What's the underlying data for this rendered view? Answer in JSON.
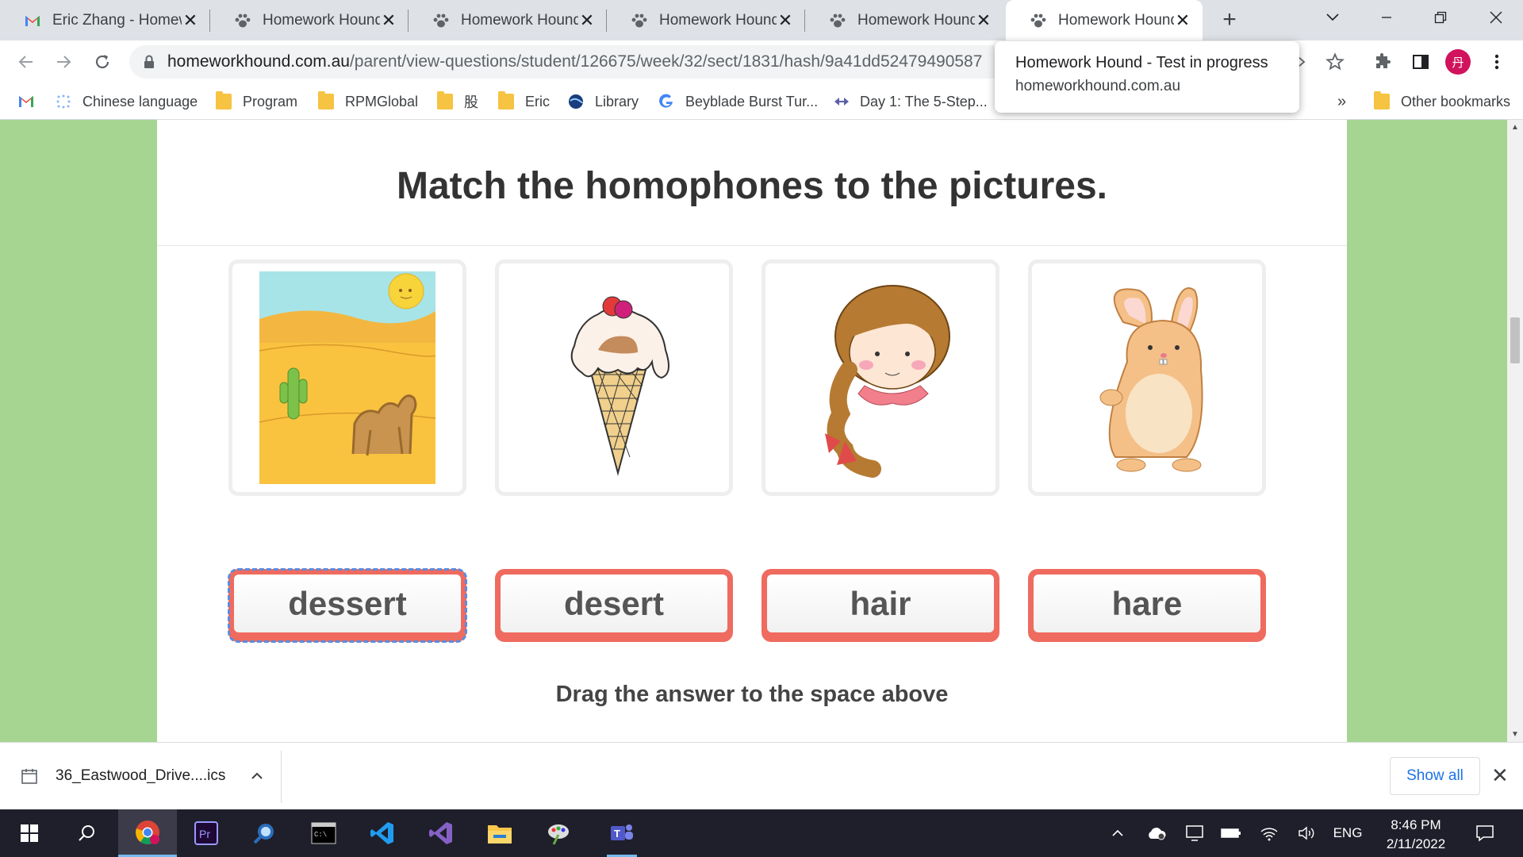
{
  "browser": {
    "tabs": [
      {
        "title": "Eric Zhang - Homew",
        "icon": "gmail-icon"
      },
      {
        "title": "Homework Hound",
        "icon": "paw-icon"
      },
      {
        "title": "Homework Hound",
        "icon": "paw-icon"
      },
      {
        "title": "Homework Hound",
        "icon": "paw-icon"
      },
      {
        "title": "Homework Hound",
        "icon": "paw-icon"
      },
      {
        "title": "Homework Hound",
        "icon": "paw-icon",
        "active": true
      }
    ],
    "new_tab_label": "+",
    "address": {
      "host": "homeworkhound.com.au",
      "path": "/parent/view-questions/student/126675/week/32/sect/1831/hash/9a41dd52479490587"
    },
    "hover_card": {
      "title": "Homework Hound - Test in progress",
      "url": "homeworkhound.com.au"
    },
    "profile_initial": "丹",
    "bookmarks": [
      {
        "label": "",
        "icon": "gmail-icon"
      },
      {
        "label": "Chinese language",
        "icon": "globe-dots-icon"
      },
      {
        "label": "Program",
        "icon": "folder-icon"
      },
      {
        "label": "RPMGlobal",
        "icon": "folder-icon"
      },
      {
        "label": "股",
        "icon": "folder-icon"
      },
      {
        "label": "Eric",
        "icon": "folder-icon"
      },
      {
        "label": "Library",
        "icon": "globe-icon"
      },
      {
        "label": "Beyblade Burst Tur...",
        "icon": "google-icon"
      },
      {
        "label": "Day 1: The 5-Step...",
        "icon": "link-icon"
      }
    ],
    "bookmarks_overflow": "»",
    "other_bookmarks": "Other bookmarks"
  },
  "page": {
    "heading": "Match the homophones to the pictures.",
    "pictures": [
      {
        "name": "desert-picture",
        "subject": "desert with cactus and camel"
      },
      {
        "name": "dessert-picture",
        "subject": "ice cream cone"
      },
      {
        "name": "hair-picture",
        "subject": "girl with braided hair"
      },
      {
        "name": "hare-picture",
        "subject": "rabbit"
      }
    ],
    "answers": [
      "dessert",
      "desert",
      "hair",
      "hare"
    ],
    "instruction": "Drag the answer to the space above"
  },
  "downloads": {
    "file": "36_Eastwood_Drive....ics",
    "show_all": "Show all"
  },
  "taskbar": {
    "apps": [
      "chrome-icon",
      "premiere-icon",
      "search-app-icon",
      "terminal-icon",
      "vscode-icon",
      "visual-studio-icon",
      "file-explorer-icon",
      "paint-icon",
      "teams-icon"
    ],
    "language": "ENG",
    "time": "8:46 PM",
    "date": "2/11/2022"
  },
  "colors": {
    "page_background": "#a5d591",
    "answer_border": "#ef6b5f",
    "focus_outline": "#5a8de0"
  }
}
